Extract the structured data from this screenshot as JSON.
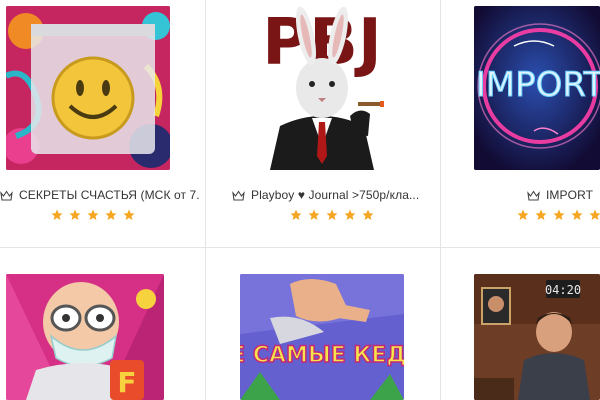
{
  "colors": {
    "star": "#f5a623",
    "divider": "#e4e4e4",
    "caption_text": "#333333"
  },
  "icons": {
    "crown": "crown-icon",
    "star": "star-icon",
    "heart": "heart-icon"
  },
  "products": [
    {
      "title": "СЕКРЕТЫ СЧАСТЬЯ (МСК от 7...",
      "rating": 5,
      "image": "smiley-pill-bag"
    },
    {
      "title": "Playboy ♥ Journal >750р/кла...",
      "rating": 5,
      "image": "rabbit-in-suit",
      "image_text": "PBJ"
    },
    {
      "title": "IMPORT",
      "rating": 5,
      "image": "neon-sign",
      "image_text": "IMPORT"
    },
    {
      "title": "",
      "rating": null,
      "image": "doctor-cartoon"
    },
    {
      "title": "",
      "rating": null,
      "image": "sneakers-poster",
      "image_text": "ТЕ САМЫЕ КЕДЫ"
    },
    {
      "title": "",
      "rating": null,
      "image": "man-in-room",
      "image_text": "04:20"
    }
  ]
}
